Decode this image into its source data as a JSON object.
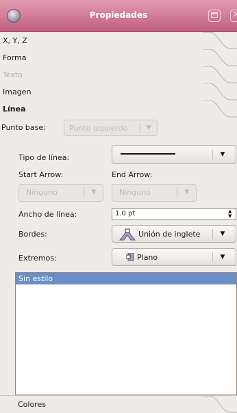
{
  "window": {
    "title": "Propiedades"
  },
  "tabs": {
    "xyz": "X, Y, Z",
    "forma": "Forma",
    "texto": "Texto",
    "imagen": "Imagen",
    "linea": "Línea",
    "colores": "Colores"
  },
  "linea": {
    "base_point_label": "Punto base:",
    "base_point_value": "Punto izquierdo",
    "line_type_label": "Tipo de línea:",
    "start_arrow_label": "Start Arrow:",
    "end_arrow_label": "End Arrow:",
    "start_arrow_value": "Ninguno",
    "end_arrow_value": "Ninguno",
    "width_label": "Ancho de línea:",
    "width_value": "1.0 pt",
    "edges_label": "Bordes:",
    "edges_value": "Unión de inglete",
    "caps_label": "Extremos:",
    "caps_value": "Plano"
  },
  "styles": {
    "items": [
      "Sin estilo"
    ]
  }
}
